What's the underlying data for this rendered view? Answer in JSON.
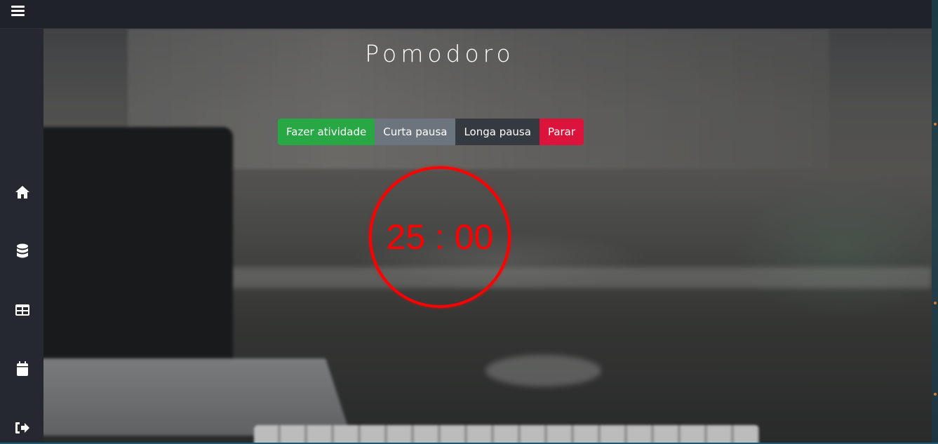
{
  "topbar": {
    "menu_icon": "hamburger-menu-icon"
  },
  "sidebar": {
    "items": [
      {
        "icon": "home-icon"
      },
      {
        "icon": "database-icon"
      },
      {
        "icon": "table-icon"
      },
      {
        "icon": "calendar-icon"
      },
      {
        "icon": "logout-icon"
      }
    ]
  },
  "main": {
    "title": "Pomodoro",
    "modes": [
      {
        "label": "Fazer atividade",
        "color": "#28a745"
      },
      {
        "label": "Curta pausa",
        "color": "#6c757d"
      },
      {
        "label": "Longa pausa",
        "color": "#343a40"
      },
      {
        "label": "Parar",
        "color": "#dc143c"
      }
    ],
    "timer": {
      "display": "25 : 00",
      "color": "#ff0000"
    }
  }
}
